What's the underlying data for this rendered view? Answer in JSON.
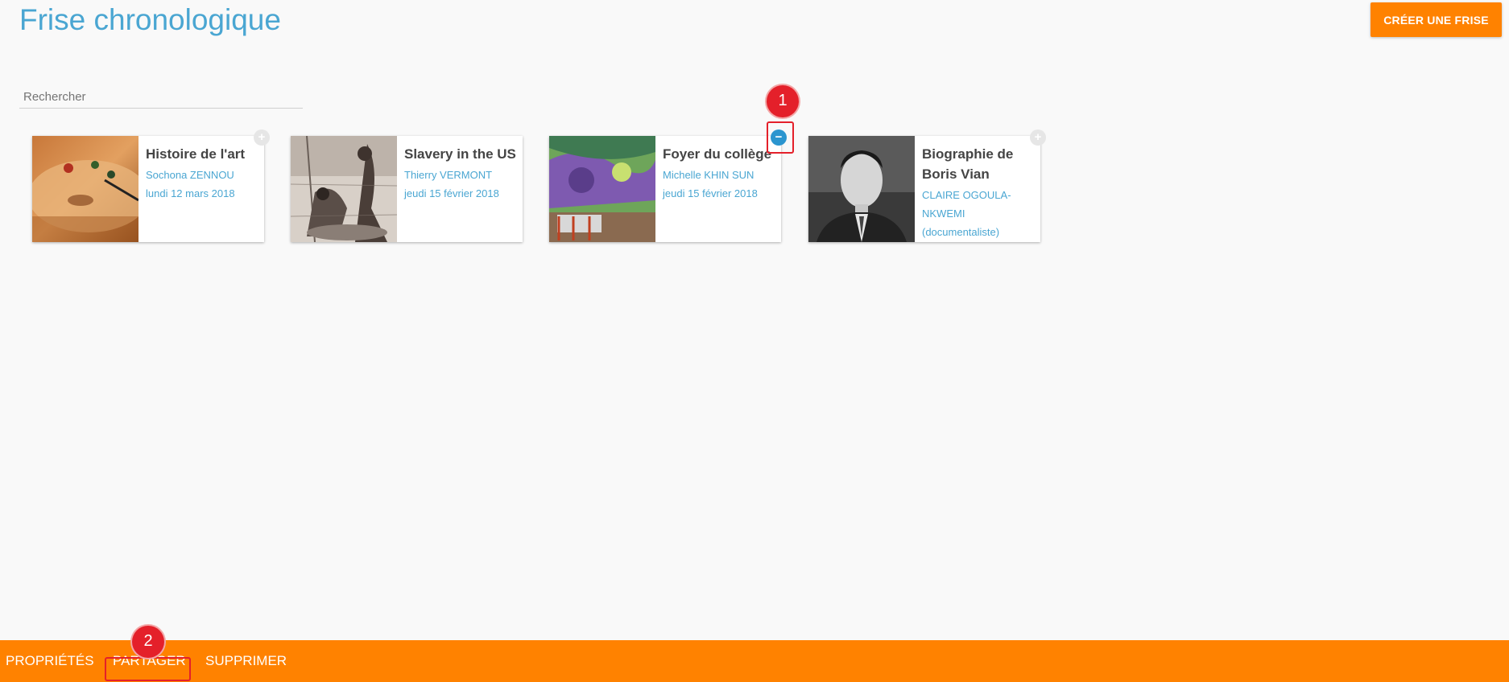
{
  "header": {
    "title": "Frise chronologique",
    "create_button": "CRÉER UNE FRISE"
  },
  "search": {
    "placeholder": "Rechercher"
  },
  "cards": [
    {
      "title": "Histoire de l'art",
      "author": "Sochona ZENNOU",
      "date": "lundi 12 mars 2018",
      "selected": false
    },
    {
      "title": "Slavery in the US",
      "author": "Thierry VERMONT",
      "date": "jeudi 15 février 2018",
      "selected": false
    },
    {
      "title": "Foyer du collège",
      "author": "Michelle KHIN SUN",
      "date": "jeudi 15 février 2018",
      "selected": true
    },
    {
      "title": "Biographie de Boris Vian",
      "author": "CLAIRE OGOULA-NKWEMI (documentaliste)",
      "date": "",
      "selected": false
    }
  ],
  "select_icons": {
    "unselected": "+",
    "selected": "−"
  },
  "annotations": [
    "1",
    "2"
  ],
  "bottom_bar": {
    "actions": [
      "PROPRIÉTÉS",
      "PARTAGER",
      "SUPPRIMER"
    ]
  },
  "colors": {
    "accent": "#ff8200",
    "link": "#4aa6d2",
    "highlight": "#e4202a"
  }
}
